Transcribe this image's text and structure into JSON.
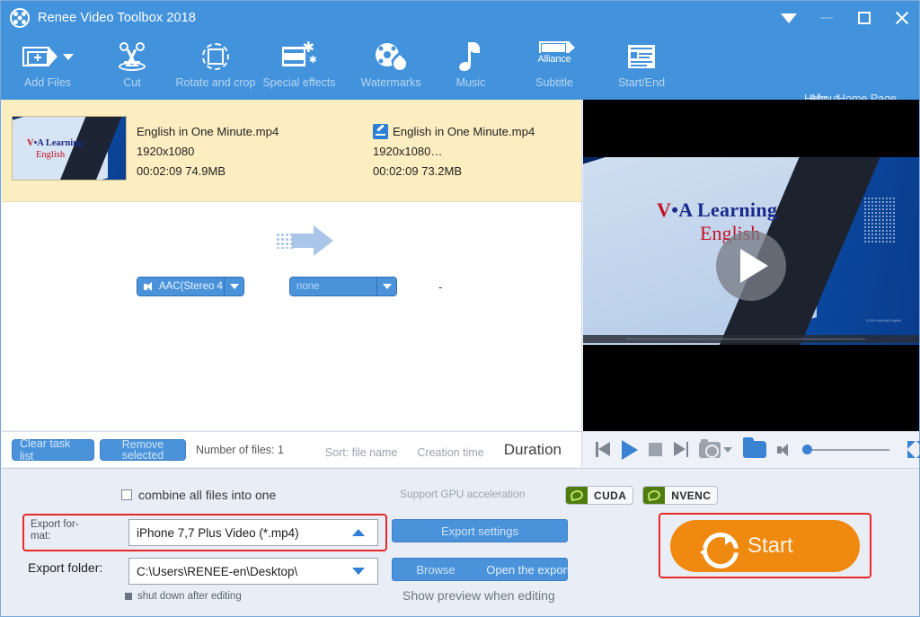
{
  "window": {
    "title": "Renee Video Toolbox 2018",
    "logo_icon": "film-reel-icon",
    "controls": {
      "dropdown_icon": "caret-down-icon",
      "minimize_icon": "minimize-icon",
      "maximize_icon": "maximize-icon",
      "close_icon": "close-icon"
    }
  },
  "toolbar": {
    "items": [
      {
        "label": "Add Files",
        "icon": "add-files-icon",
        "has_caret": true
      },
      {
        "label": "Cut",
        "icon": "scissors-icon",
        "has_caret": false
      },
      {
        "label": "Rotate and crop",
        "icon": "crop-rotate-icon",
        "has_caret": false
      },
      {
        "label": "Special effects",
        "icon": "special-effects-icon",
        "has_caret": false
      },
      {
        "label": "Watermarks",
        "icon": "watermark-icon",
        "has_caret": false
      },
      {
        "label": "Music",
        "icon": "music-note-icon",
        "has_caret": false
      },
      {
        "label": "Subtitle",
        "icon": "subtitle-icon",
        "icon_text": "Alliance",
        "has_caret": false
      },
      {
        "label": "Start/End",
        "icon": "start-end-icon",
        "has_caret": false
      }
    ],
    "links": {
      "help": "Help",
      "about": "About",
      "home_page": "Home Page"
    }
  },
  "file_list": {
    "rows": [
      {
        "thumbnail": {
          "brand_prefix": "V",
          "brand_rest": "•A Learning",
          "brand_sub": "English"
        },
        "source": {
          "name": "English in One Minute.mp4",
          "resolution": "1920x1080",
          "duration_size": "00:02:09  74.9MB"
        },
        "arrow_icon": "right-arrow-icon",
        "target": {
          "edit_icon": "edit-pencil-icon",
          "name": "English in One Minute.mp4",
          "resolution": "1920x1080…",
          "duration_size": "00:02:09  73.2MB"
        },
        "audio_track": {
          "icon": "speaker-icon",
          "value": "AAC(Stereo 4",
          "caret": "caret-down-icon"
        },
        "subtitle_track": {
          "value": "none",
          "caret": "caret-down-icon"
        },
        "extra": "-"
      }
    ]
  },
  "list_footer": {
    "clear_task_list": "Clear task list",
    "remove_selected": "Remove selected",
    "number_of_files": "Number of files: 1",
    "sort_file_name": "Sort: file name",
    "creation_time": "Creation time",
    "duration": "Duration"
  },
  "preview": {
    "play_overlay_icon": "play-circle-icon",
    "brand_prefix": "V",
    "brand_rest": "•A Learning",
    "brand_sub": "English",
    "fineprint": "VOA Learning\nEnglish"
  },
  "player_controls": {
    "previous": "previous-icon",
    "play": "play-icon",
    "stop": "stop-icon",
    "next": "next-icon",
    "snapshot": "camera-icon",
    "snapshot_caret": "caret-down-icon",
    "open_folder": "folder-icon",
    "volume": "volume-icon",
    "volume_slider": "volume-slider",
    "fullscreen": "fullscreen-icon"
  },
  "export_panel": {
    "combine_label": "combine all files into one",
    "combine_checked": false,
    "export_format_label": "Export for-\nmat:",
    "export_format_value": "iPhone 7,7 Plus Video (*.mp4)",
    "export_format_caret": "caret-up-icon",
    "export_folder_label": "Export folder:",
    "export_folder_value": "C:\\Users\\RENEE-en\\Desktop\\",
    "export_folder_caret": "caret-down-icon",
    "shutdown_label": "shut down after editing",
    "gpu_label": "Support GPU acceleration",
    "badges": [
      {
        "name": "CUDA",
        "icon": "nvidia-icon"
      },
      {
        "name": "NVENC",
        "icon": "nvidia-icon"
      }
    ],
    "export_settings": "Export settings",
    "browse": "Browse",
    "open_export_file": "Open the export file",
    "show_preview": "Show preview when editing",
    "start_button": "Start",
    "start_icon": "refresh-icon",
    "highlight_color": "#e8282a",
    "start_color": "#f0890f",
    "accent_color": "#4292dc"
  }
}
